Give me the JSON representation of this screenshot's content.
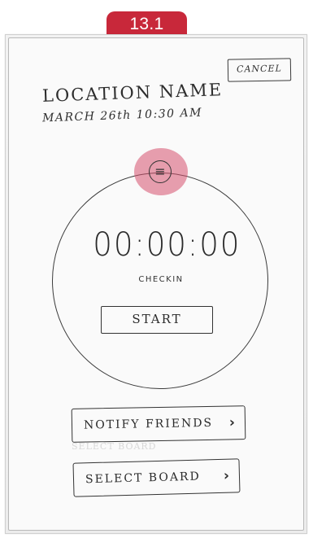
{
  "step_badge": "13.1",
  "header": {
    "cancel_label": "CANCEL",
    "location_name": "LOCATION NAME",
    "date_time": "MARCH 26th 10:30 AM"
  },
  "timer": {
    "menu_icon": "≡",
    "value": "00:00:00",
    "status_label": "CHECKIN",
    "start_label": "START"
  },
  "actions": {
    "notify_label": "NOTIFY FRIENDS",
    "select_board_label": "SELECT BOARD",
    "chevron": "›"
  },
  "ghost_text": "SELECT BOARD",
  "colors": {
    "step_badge": "#c8283a",
    "marker": "#d6506e"
  }
}
